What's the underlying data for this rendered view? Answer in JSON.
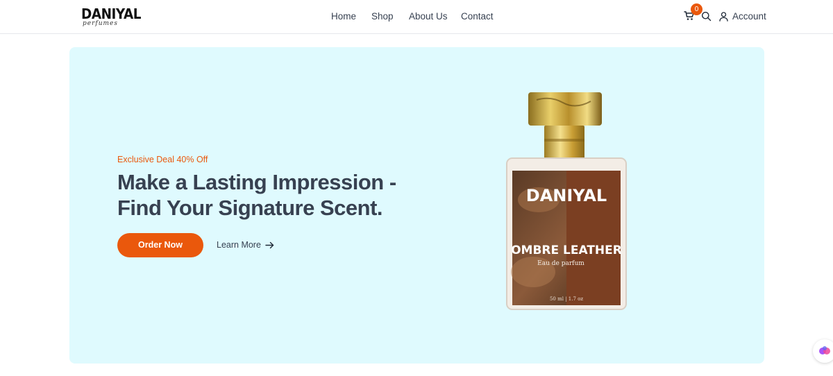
{
  "brand": {
    "name": "DANIYAL",
    "tagline": "perfumes"
  },
  "nav": {
    "items": [
      {
        "label": "Home"
      },
      {
        "label": "Shop"
      },
      {
        "label": "About Us"
      },
      {
        "label": "Contact"
      }
    ]
  },
  "header_actions": {
    "cart_count": "0",
    "cart_icon": "cart-icon",
    "search_icon": "search-icon",
    "account_icon": "user-icon",
    "account_label": "Account"
  },
  "hero": {
    "eyebrow": "Exclusive Deal 40% Off",
    "headline_line1": "Make a Lasting Impression -",
    "headline_line2": "Find Your Signature Scent.",
    "primary_button": "Order Now",
    "secondary_button": "Learn More",
    "background_color": "#dffafe",
    "accent_color": "#ea580c",
    "product_image": {
      "brand": "DANIYAL",
      "name": "OMBRE LEATHER",
      "type": "Eau de parfum",
      "volume": "50 ml | 1.7 oz"
    }
  },
  "floating_button": {
    "icon": "ai-assistant-icon"
  }
}
